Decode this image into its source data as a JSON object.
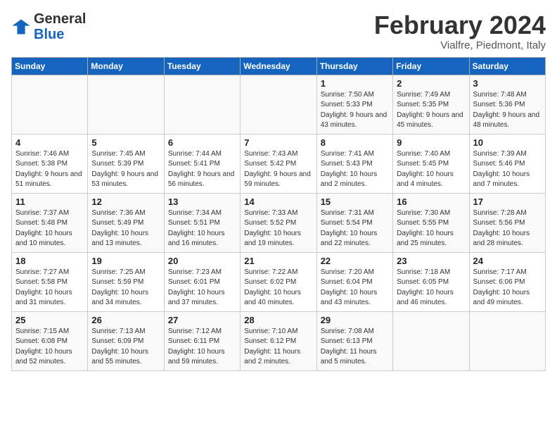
{
  "header": {
    "logo_general": "General",
    "logo_blue": "Blue",
    "month_title": "February 2024",
    "subtitle": "Vialfre, Piedmont, Italy"
  },
  "days_of_week": [
    "Sunday",
    "Monday",
    "Tuesday",
    "Wednesday",
    "Thursday",
    "Friday",
    "Saturday"
  ],
  "weeks": [
    {
      "days": [
        {
          "num": "",
          "empty": true
        },
        {
          "num": "",
          "empty": true
        },
        {
          "num": "",
          "empty": true
        },
        {
          "num": "",
          "empty": true
        },
        {
          "num": "1",
          "sunrise": "7:50 AM",
          "sunset": "5:33 PM",
          "daylight": "9 hours and 43 minutes."
        },
        {
          "num": "2",
          "sunrise": "7:49 AM",
          "sunset": "5:35 PM",
          "daylight": "9 hours and 45 minutes."
        },
        {
          "num": "3",
          "sunrise": "7:48 AM",
          "sunset": "5:36 PM",
          "daylight": "9 hours and 48 minutes."
        }
      ]
    },
    {
      "days": [
        {
          "num": "4",
          "sunrise": "7:46 AM",
          "sunset": "5:38 PM",
          "daylight": "9 hours and 51 minutes."
        },
        {
          "num": "5",
          "sunrise": "7:45 AM",
          "sunset": "5:39 PM",
          "daylight": "9 hours and 53 minutes."
        },
        {
          "num": "6",
          "sunrise": "7:44 AM",
          "sunset": "5:41 PM",
          "daylight": "9 hours and 56 minutes."
        },
        {
          "num": "7",
          "sunrise": "7:43 AM",
          "sunset": "5:42 PM",
          "daylight": "9 hours and 59 minutes."
        },
        {
          "num": "8",
          "sunrise": "7:41 AM",
          "sunset": "5:43 PM",
          "daylight": "10 hours and 2 minutes."
        },
        {
          "num": "9",
          "sunrise": "7:40 AM",
          "sunset": "5:45 PM",
          "daylight": "10 hours and 4 minutes."
        },
        {
          "num": "10",
          "sunrise": "7:39 AM",
          "sunset": "5:46 PM",
          "daylight": "10 hours and 7 minutes."
        }
      ]
    },
    {
      "days": [
        {
          "num": "11",
          "sunrise": "7:37 AM",
          "sunset": "5:48 PM",
          "daylight": "10 hours and 10 minutes."
        },
        {
          "num": "12",
          "sunrise": "7:36 AM",
          "sunset": "5:49 PM",
          "daylight": "10 hours and 13 minutes."
        },
        {
          "num": "13",
          "sunrise": "7:34 AM",
          "sunset": "5:51 PM",
          "daylight": "10 hours and 16 minutes."
        },
        {
          "num": "14",
          "sunrise": "7:33 AM",
          "sunset": "5:52 PM",
          "daylight": "10 hours and 19 minutes."
        },
        {
          "num": "15",
          "sunrise": "7:31 AM",
          "sunset": "5:54 PM",
          "daylight": "10 hours and 22 minutes."
        },
        {
          "num": "16",
          "sunrise": "7:30 AM",
          "sunset": "5:55 PM",
          "daylight": "10 hours and 25 minutes."
        },
        {
          "num": "17",
          "sunrise": "7:28 AM",
          "sunset": "5:56 PM",
          "daylight": "10 hours and 28 minutes."
        }
      ]
    },
    {
      "days": [
        {
          "num": "18",
          "sunrise": "7:27 AM",
          "sunset": "5:58 PM",
          "daylight": "10 hours and 31 minutes."
        },
        {
          "num": "19",
          "sunrise": "7:25 AM",
          "sunset": "5:59 PM",
          "daylight": "10 hours and 34 minutes."
        },
        {
          "num": "20",
          "sunrise": "7:23 AM",
          "sunset": "6:01 PM",
          "daylight": "10 hours and 37 minutes."
        },
        {
          "num": "21",
          "sunrise": "7:22 AM",
          "sunset": "6:02 PM",
          "daylight": "10 hours and 40 minutes."
        },
        {
          "num": "22",
          "sunrise": "7:20 AM",
          "sunset": "6:04 PM",
          "daylight": "10 hours and 43 minutes."
        },
        {
          "num": "23",
          "sunrise": "7:18 AM",
          "sunset": "6:05 PM",
          "daylight": "10 hours and 46 minutes."
        },
        {
          "num": "24",
          "sunrise": "7:17 AM",
          "sunset": "6:06 PM",
          "daylight": "10 hours and 49 minutes."
        }
      ]
    },
    {
      "days": [
        {
          "num": "25",
          "sunrise": "7:15 AM",
          "sunset": "6:08 PM",
          "daylight": "10 hours and 52 minutes."
        },
        {
          "num": "26",
          "sunrise": "7:13 AM",
          "sunset": "6:09 PM",
          "daylight": "10 hours and 55 minutes."
        },
        {
          "num": "27",
          "sunrise": "7:12 AM",
          "sunset": "6:11 PM",
          "daylight": "10 hours and 59 minutes."
        },
        {
          "num": "28",
          "sunrise": "7:10 AM",
          "sunset": "6:12 PM",
          "daylight": "11 hours and 2 minutes."
        },
        {
          "num": "29",
          "sunrise": "7:08 AM",
          "sunset": "6:13 PM",
          "daylight": "11 hours and 5 minutes."
        },
        {
          "num": "",
          "empty": true
        },
        {
          "num": "",
          "empty": true
        }
      ]
    }
  ],
  "labels": {
    "sunrise_prefix": "Sunrise: ",
    "sunset_prefix": "Sunset: ",
    "daylight_prefix": "Daylight: "
  }
}
